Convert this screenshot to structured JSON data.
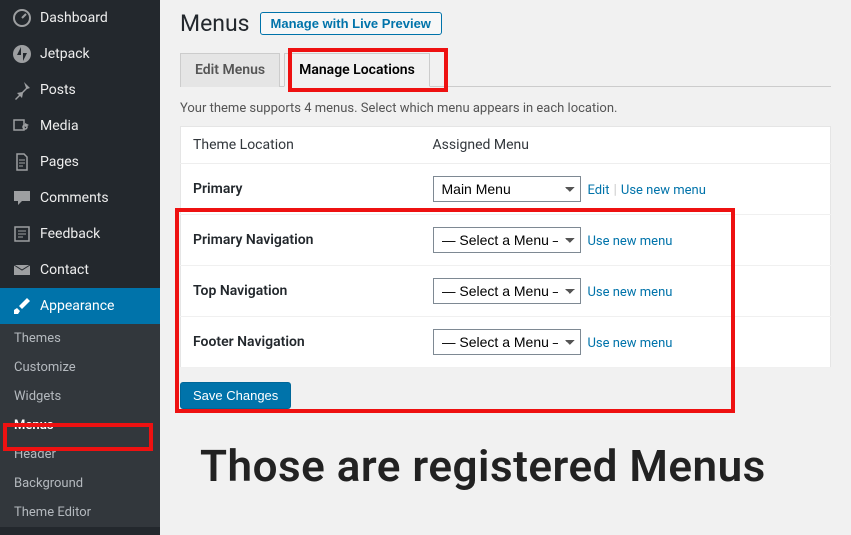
{
  "sidebar": {
    "items": [
      {
        "label": "Dashboard"
      },
      {
        "label": "Jetpack"
      },
      {
        "label": "Posts"
      },
      {
        "label": "Media"
      },
      {
        "label": "Pages"
      },
      {
        "label": "Comments"
      },
      {
        "label": "Feedback"
      },
      {
        "label": "Contact"
      },
      {
        "label": "Appearance"
      }
    ],
    "sub": [
      {
        "label": "Themes"
      },
      {
        "label": "Customize"
      },
      {
        "label": "Widgets"
      },
      {
        "label": "Menus"
      },
      {
        "label": "Header"
      },
      {
        "label": "Background"
      },
      {
        "label": "Theme Editor"
      }
    ]
  },
  "title": "Menus",
  "preview_btn": "Manage with Live Preview",
  "tabs": {
    "edit": "Edit Menus",
    "manage": "Manage Locations"
  },
  "desc": "Your theme supports 4 menus. Select which menu appears in each location.",
  "table": {
    "head": {
      "loc": "Theme Location",
      "menu": "Assigned Menu"
    },
    "rows": [
      {
        "loc": "Primary",
        "sel": "Main Menu",
        "edit": "Edit",
        "usenew": "Use new menu"
      },
      {
        "loc": "Primary Navigation",
        "sel": "— Select a Menu —",
        "usenew": "Use new menu"
      },
      {
        "loc": "Top Navigation",
        "sel": "— Select a Menu —",
        "usenew": "Use new menu"
      },
      {
        "loc": "Footer Navigation",
        "sel": "— Select a Menu —",
        "usenew": "Use new menu"
      }
    ]
  },
  "save": "Save Changes",
  "caption": "Those are registered Menus"
}
